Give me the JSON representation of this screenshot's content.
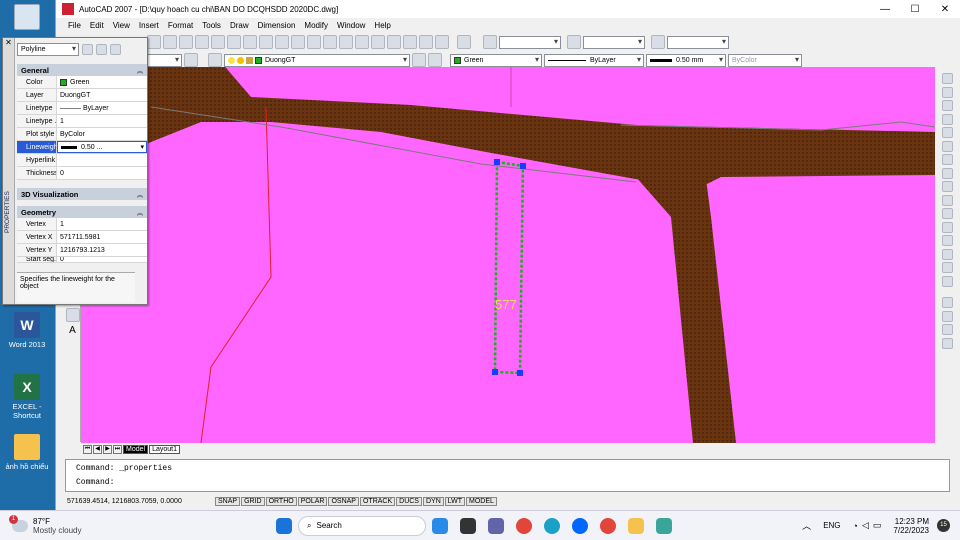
{
  "desktop": {
    "recycle_label": "",
    "icons": [
      {
        "label": "Word 2013",
        "color": "#2b579a"
      },
      {
        "label": "EXCEL - Shortcut",
        "color": "#217346"
      },
      {
        "label": "ảnh hồ chiểu",
        "color": "#f4c24d"
      }
    ]
  },
  "window": {
    "title": "AutoCAD 2007 - [D:\\quy hoach cu chi\\BAN DO DCQHSDD 2020DC.dwg]",
    "minimize": "—",
    "maximize": "☐",
    "close": "✕"
  },
  "menu": [
    "File",
    "Edit",
    "View",
    "Insert",
    "Format",
    "Tools",
    "Draw",
    "Dimension",
    "Modify",
    "Window",
    "Help"
  ],
  "layers_toolbar": {
    "layer": "DuongGT",
    "color": "Green",
    "linetype": "ByLayer",
    "lineweight": "0.50 mm",
    "plotstyle": "ByColor"
  },
  "properties": {
    "panel_label": "PROPERTIES",
    "object_type": "Polyline",
    "general_title": "General",
    "general": [
      {
        "k": "Color",
        "v": "Green"
      },
      {
        "k": "Layer",
        "v": "DuongGT"
      },
      {
        "k": "Linetype",
        "v": "——— ByLayer"
      },
      {
        "k": "Linetype ...",
        "v": "1"
      },
      {
        "k": "Plot style",
        "v": "ByColor"
      },
      {
        "k": "Lineweight",
        "v": "0.50 ..."
      },
      {
        "k": "Hyperlink",
        "v": ""
      },
      {
        "k": "Thickness",
        "v": "0"
      }
    ],
    "viz_title": "3D Visualization",
    "geometry_title": "Geometry",
    "geometry": [
      {
        "k": "Vertex",
        "v": "1"
      },
      {
        "k": "Vertex X",
        "v": "571711.5981"
      },
      {
        "k": "Vertex Y",
        "v": "1216793.1213"
      },
      {
        "k": "Start seg...",
        "v": "0"
      }
    ],
    "help_text": "Specifies the lineweight for the object"
  },
  "canvas": {
    "bg": "#ff66ff",
    "road_color": "#6b3410",
    "label": "577"
  },
  "tabs": {
    "nav": [
      "⏮",
      "◀",
      "▶",
      "⏭"
    ],
    "items": [
      "Model",
      "Layout1"
    ],
    "active": "Model"
  },
  "command": {
    "line1": "Command: _properties",
    "line2": "Command:"
  },
  "status": {
    "coords": "571639.4514, 1216803.7059, 0.0000",
    "modes": [
      "SNAP",
      "GRID",
      "ORTHO",
      "POLAR",
      "OSNAP",
      "OTRACK",
      "DUCS",
      "DYN",
      "LWT",
      "MODEL"
    ]
  },
  "taskbar": {
    "weather_temp": "87°F",
    "weather_desc": "Mostly cloudy",
    "weather_badge": "1",
    "search": "Search",
    "lang": "ENG",
    "time": "12:23 PM",
    "date": "7/22/2023",
    "notif": "15"
  }
}
